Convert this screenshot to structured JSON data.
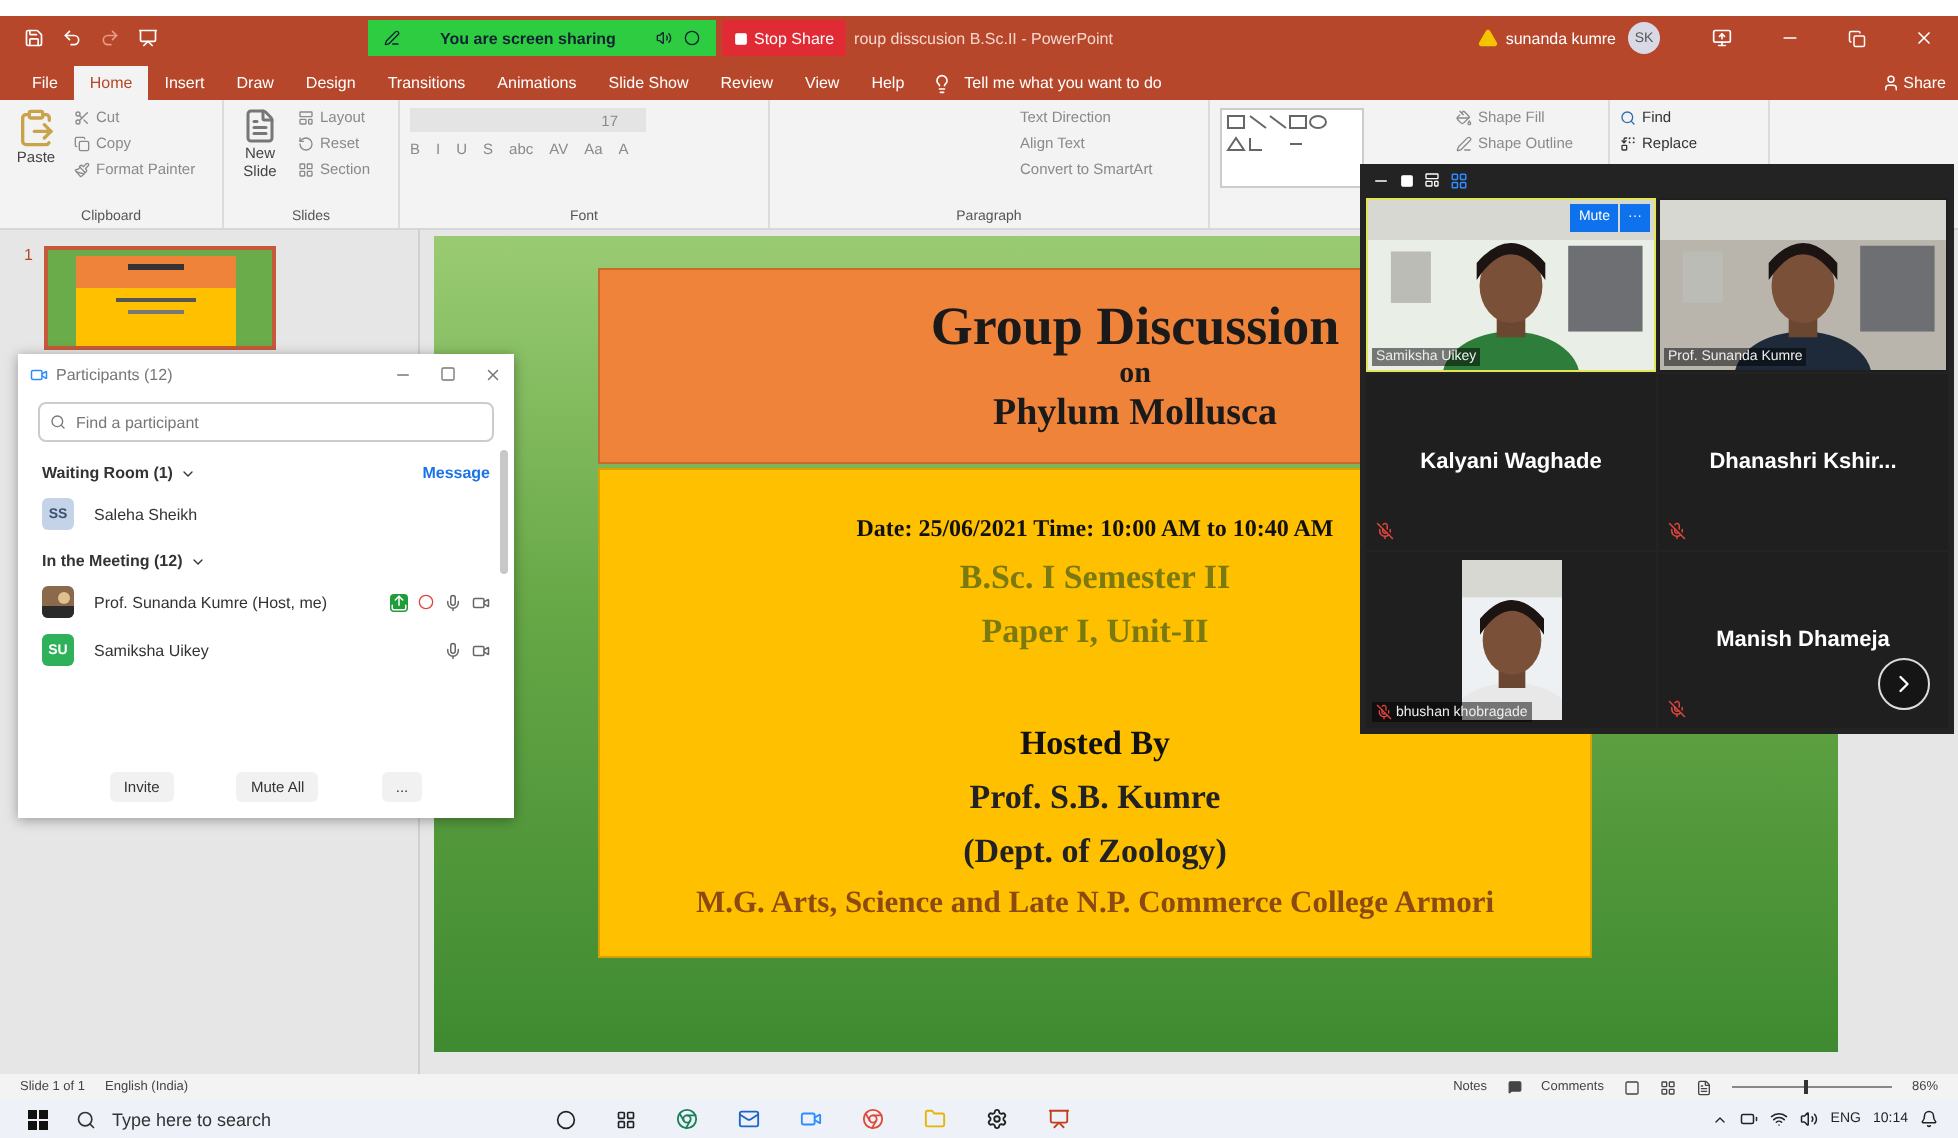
{
  "title_bar": {
    "document_title": "roup disscusion B.Sc.II  -  PowerPoint",
    "user_name": "sunanda kumre",
    "user_initials": "SK"
  },
  "share_bar": {
    "status": "You are screen sharing",
    "stop_label": "Stop Share"
  },
  "ribbon_tabs": [
    {
      "label": "File",
      "selected": false
    },
    {
      "label": "Home",
      "selected": true
    },
    {
      "label": "Insert",
      "selected": false
    },
    {
      "label": "Draw",
      "selected": false
    },
    {
      "label": "Design",
      "selected": false
    },
    {
      "label": "Transitions",
      "selected": false
    },
    {
      "label": "Animations",
      "selected": false
    },
    {
      "label": "Slide Show",
      "selected": false
    },
    {
      "label": "Review",
      "selected": false
    },
    {
      "label": "View",
      "selected": false
    },
    {
      "label": "Help",
      "selected": false
    }
  ],
  "tell_me": "Tell me what you want to do",
  "share_label": "Share",
  "clipboard": {
    "paste": "Paste",
    "cut": "Cut",
    "copy": "Copy",
    "format_painter": "Format Painter",
    "label": "Clipboard"
  },
  "slides_group": {
    "new_slide": "New Slide",
    "layout": "Layout",
    "reset": "Reset",
    "section": "Section",
    "label": "Slides"
  },
  "font_group": {
    "size": "17",
    "format_buttons": [
      "B",
      "I",
      "U",
      "S",
      "abc",
      "AV",
      "Aa",
      "A"
    ],
    "label": "Font"
  },
  "paragraph_group": {
    "text_direction": "Text Direction",
    "align_text": "Align Text",
    "convert": "Convert to SmartArt",
    "label": "Paragraph"
  },
  "drawing_group": {
    "shape_fill": "Shape Fill",
    "shape_outline": "Shape Outline"
  },
  "editing_group": {
    "find": "Find",
    "replace": "Replace"
  },
  "thumbnail": {
    "number": "1",
    "selected": true
  },
  "slide": {
    "title": "Group Discussion",
    "subtitle": "on",
    "topic": "Phylum Mollusca",
    "lines": [
      {
        "kind": "date",
        "text": "Date: 25/06/2021 Time: 10:00 AM to 10:40 AM"
      },
      {
        "kind": "accent",
        "text": "B.Sc. I Semester II"
      },
      {
        "kind": "accent",
        "text": "Paper I, Unit-II"
      },
      {
        "kind": "gap"
      },
      {
        "kind": "heading",
        "text": "Hosted By"
      },
      {
        "kind": "host",
        "text": "Prof. S.B. Kumre"
      },
      {
        "kind": "host",
        "text": "(Dept. of Zoology)"
      },
      {
        "kind": "college",
        "text": "M.G. Arts, Science and Late N.P. Commerce College Armori"
      }
    ]
  },
  "participants": {
    "title": "Participants (12)",
    "search_placeholder": "Find a participant",
    "waiting_heading": "Waiting Room (1)",
    "message": "Message",
    "waiting": [
      {
        "name": "Saleha Sheikh",
        "initials": "SS",
        "color": "#c5d3e8"
      }
    ],
    "meeting_heading": "In the Meeting (12)",
    "members": [
      {
        "name": "Prof. Sunanda Kumre (Host, me)",
        "kind": "picture",
        "sharing": true,
        "recording": true,
        "mic_muted": false,
        "video_off": false
      },
      {
        "name": "Samiksha Uikey",
        "kind": "initials",
        "initials": "SU",
        "color": "#2fb15a",
        "sharing": false,
        "recording": false,
        "mic_muted": false,
        "video_off": false
      }
    ],
    "buttons": [
      "Invite",
      "Mute All",
      "..."
    ]
  },
  "video_panel": {
    "mute_label": "Mute",
    "more_label": "···",
    "tiles": [
      {
        "name": "Samiksha Uikey",
        "kind": "video",
        "active": true,
        "mic_muted": false
      },
      {
        "name": "Prof. Sunanda Kumre",
        "kind": "video",
        "active": false,
        "mic_muted": false
      },
      {
        "name": "Kalyani Waghade",
        "kind": "name",
        "active": false,
        "mic_muted": true
      },
      {
        "name": "Dhanashri  Kshir...",
        "kind": "name",
        "active": false,
        "mic_muted": true
      },
      {
        "name": "bhushan khobragade",
        "kind": "small_video",
        "active": false,
        "mic_muted": true
      },
      {
        "name": "Manish Dhameja",
        "kind": "name",
        "active": false,
        "mic_muted": true
      }
    ]
  },
  "status_bar": {
    "slide_count": "Slide 1 of 1",
    "language": "English (India)",
    "notes": "Notes",
    "comments": "Comments",
    "zoom": "86%",
    "zoom_level": {
      "level": 0.45
    }
  },
  "taskbar": {
    "search_placeholder": "Type here to search",
    "language": "ENG",
    "time": "10:14"
  }
}
